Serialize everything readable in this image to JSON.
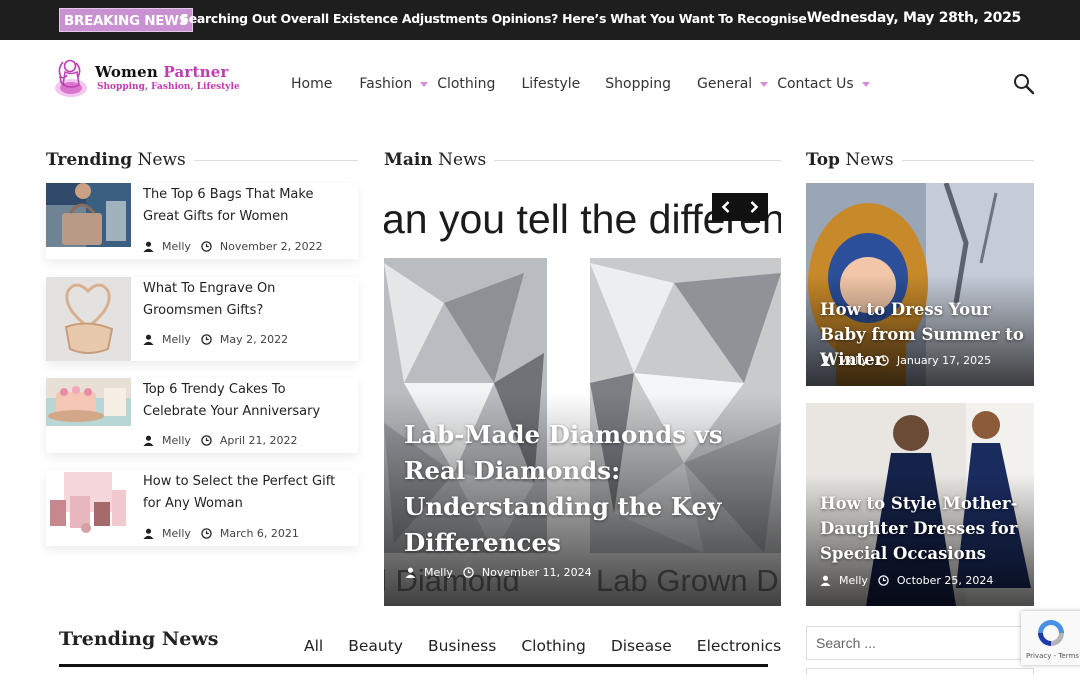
{
  "topbar": {
    "badge": "BREAKING NEWS",
    "headline": "Searching Out Overall Existence Adjustments Opinions? Here’s What You Want To Recognise",
    "date": "Wednesday, May 28th, 2025"
  },
  "brand": {
    "name_part1": "Women",
    "name_part2": "Partner",
    "tagline": "Shopping, Fashion, Lifestyle",
    "accent": "#c13bb4"
  },
  "nav": {
    "items": [
      {
        "label": "Home",
        "has_dropdown": false
      },
      {
        "label": "Fashion",
        "has_dropdown": true
      },
      {
        "label": "Clothing",
        "has_dropdown": false
      },
      {
        "label": "Lifestyle",
        "has_dropdown": false
      },
      {
        "label": "Shopping",
        "has_dropdown": false
      },
      {
        "label": "General",
        "has_dropdown": true
      },
      {
        "label": "Contact Us",
        "has_dropdown": true
      }
    ]
  },
  "trending": {
    "heading_bold": "Trending",
    "heading_rest": "News",
    "items": [
      {
        "title": "The Top 6 Bags That Make Great Gifts for Women",
        "author": "Melly",
        "date": "November 2, 2022"
      },
      {
        "title": "What To Engrave On Groomsmen Gifts?",
        "author": "Melly",
        "date": "May 2, 2022"
      },
      {
        "title": "Top 6 Trendy Cakes To Celebrate Your Anniversary",
        "author": "Melly",
        "date": "April 21, 2022"
      },
      {
        "title": "How to Select the Perfect Gift for Any Woman",
        "author": "Melly",
        "date": "March 6, 2021"
      }
    ]
  },
  "main": {
    "heading_bold": "Main",
    "heading_rest": "News",
    "slide": {
      "banner_text": "an you tell the differenc",
      "bottom_text_left": "l Diamond",
      "bottom_text_right": "Lab Grown D",
      "title": "Lab-Made Diamonds vs Real Diamonds: Understanding the Key Differences",
      "author": "Melly",
      "date": "November 11, 2024"
    }
  },
  "top_news": {
    "heading_bold": "Top",
    "heading_rest": "News",
    "items": [
      {
        "title": "How to Dress Your Baby from Summer to Winter",
        "author": "Melly",
        "date": "January 17, 2025"
      },
      {
        "title": "How to Style Mother-Daughter Dresses for Special Occasions",
        "author": "Melly",
        "date": "October 25, 2024"
      }
    ]
  },
  "bottom": {
    "heading": "Trending News",
    "tabs": [
      "All",
      "Beauty",
      "Business",
      "Clothing",
      "Disease",
      "Electronics"
    ]
  },
  "sidebar": {
    "search_placeholder": "Search ..."
  },
  "recaptcha": {
    "links": "Privacy - Terms"
  }
}
